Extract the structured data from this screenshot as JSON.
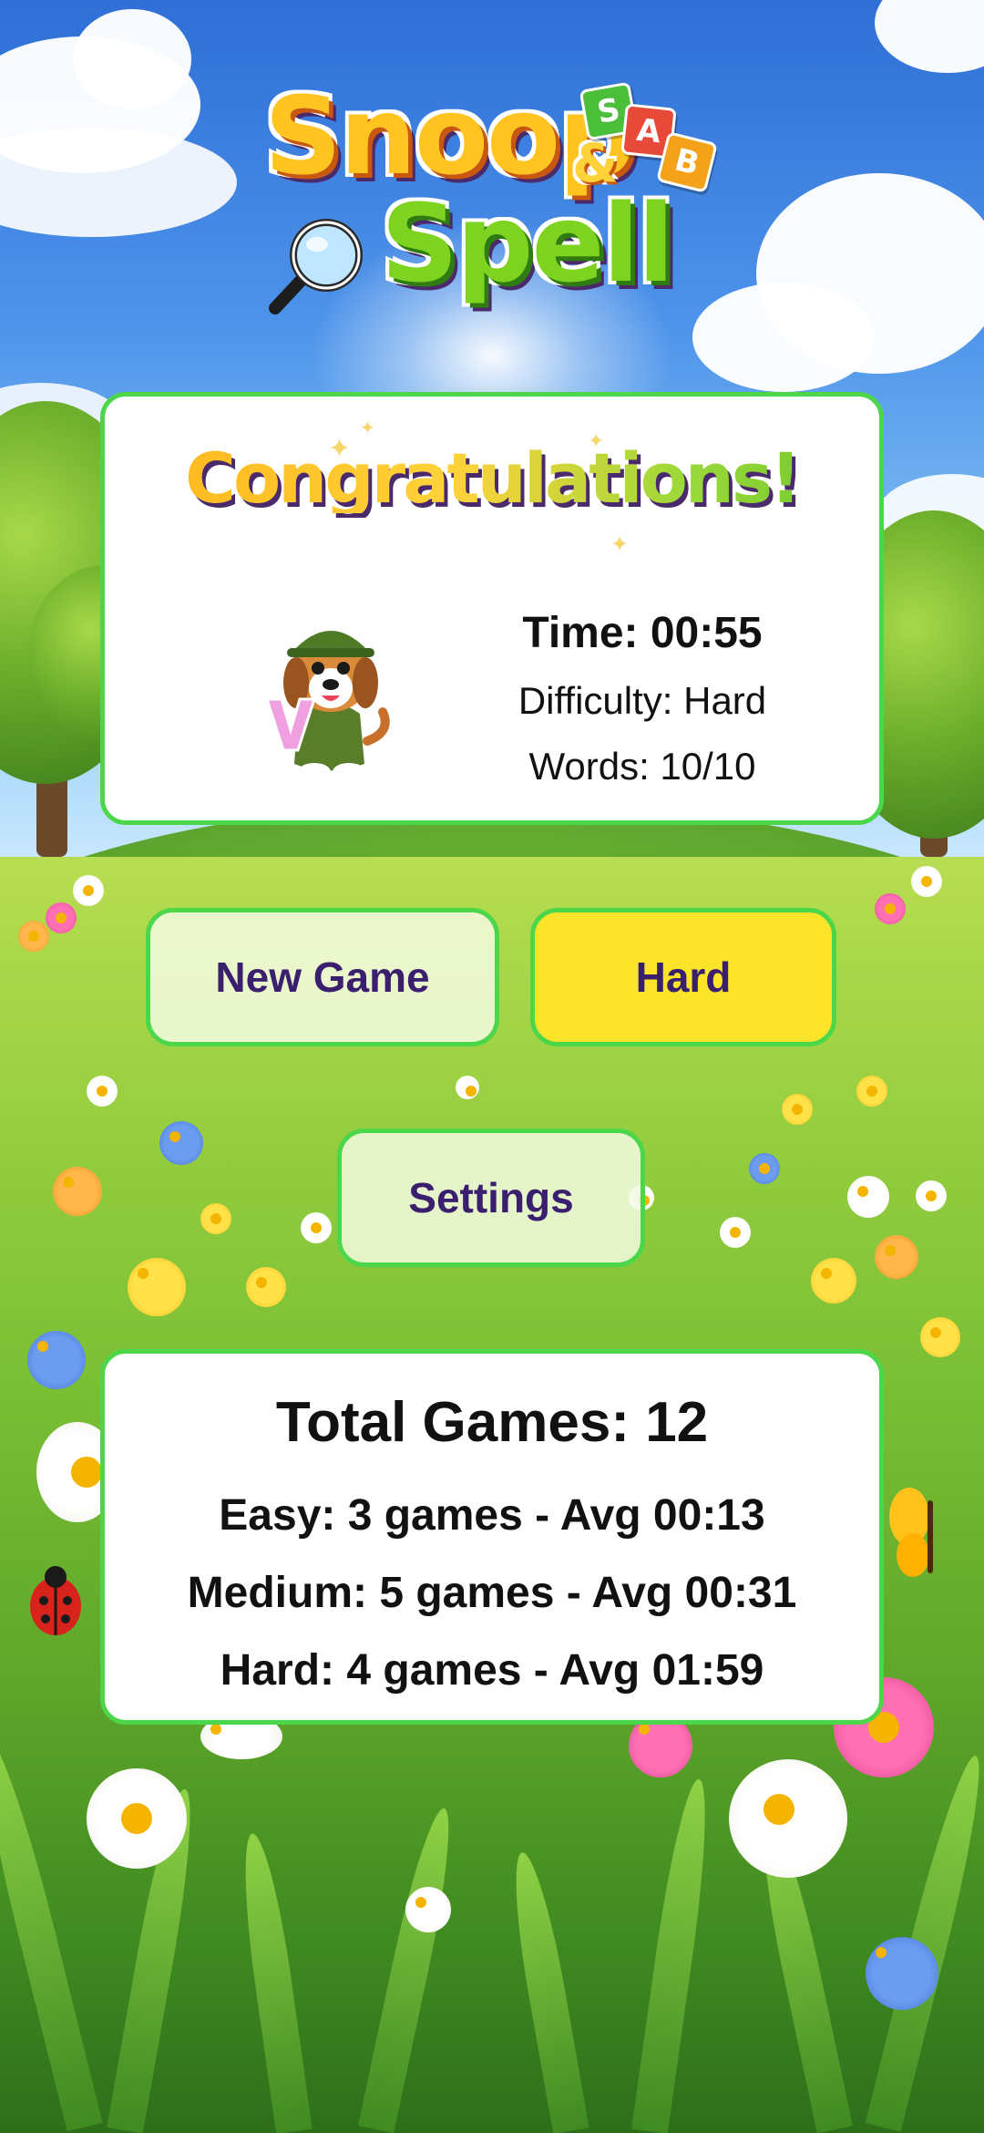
{
  "logo": {
    "line1": "Snoop",
    "amp": "&",
    "line2": "Spell",
    "tiles": [
      "S",
      "A",
      "B"
    ]
  },
  "result": {
    "title": "Congratulations!",
    "time": "Time: 00:55",
    "difficulty": "Difficulty: Hard",
    "words": "Words: 10/10"
  },
  "buttons": {
    "new_game": "New Game",
    "difficulty": "Hard",
    "settings": "Settings"
  },
  "stats": {
    "total": "Total Games: 12",
    "rows": [
      "Easy: 3 games - Avg 00:13",
      "Medium: 5 games - Avg 00:31",
      "Hard: 4 games - Avg 01:59"
    ]
  },
  "colors": {
    "card_border": "#4cd64a",
    "button_text": "#3a1f6e",
    "selected_difficulty": "#fbe42a"
  },
  "icons": {
    "magnifier": "magnifier-icon",
    "mascot": "dog-mascot",
    "ladybug": "ladybug-icon",
    "butterfly": "butterfly-icon"
  }
}
